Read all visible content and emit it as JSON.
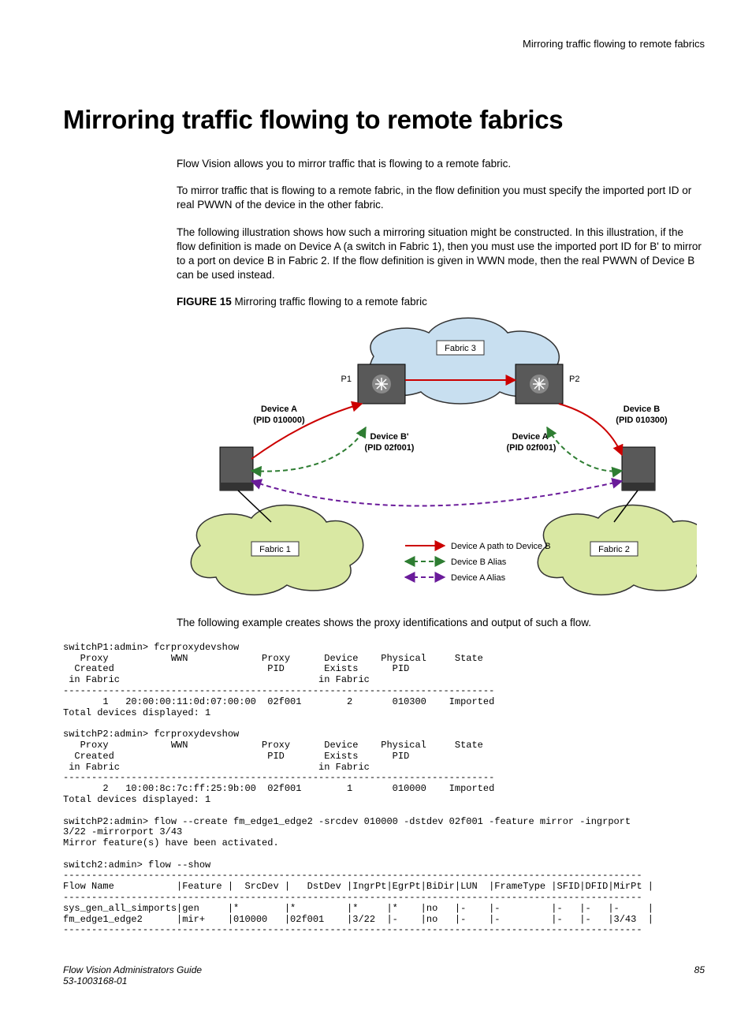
{
  "running_header": "Mirroring traffic flowing to remote fabrics",
  "title": "Mirroring traffic flowing to remote fabrics",
  "para1": "Flow Vision allows you to mirror traffic that is flowing to a remote fabric.",
  "para2": "To mirror traffic that is flowing to a remote fabric, in the flow definition you must specify the imported port ID or real PWWN of the device in the other fabric.",
  "para3": "The following illustration shows how such a mirroring situation might be constructed. In this illustration, if the flow definition is made on Device A (a switch in Fabric 1), then you must use the imported port ID for B' to mirror to a port on device B in Fabric 2. If the flow definition is given in WWN mode, then the real PWWN of Device B can be used instead.",
  "fig_label": "FIGURE 15",
  "fig_title": "Mirroring traffic flowing to a remote fabric",
  "diagram": {
    "fabric3": "Fabric 3",
    "fabric1": "Fabric 1",
    "fabric2": "Fabric 2",
    "p1": "P1",
    "p2": "P2",
    "devA_name": "Device A",
    "devA_pid": "(PID 010000)",
    "devB_name": "Device B",
    "devB_pid": "(PID 010300)",
    "devBp_name": "Device B'",
    "devBp_pid": "(PID 02f001)",
    "devAp_name": "Device A'",
    "devAp_pid": "(PID 02f001)",
    "legend1": "Device A path to Device B",
    "legend2": "Device B Alias",
    "legend3": "Device A Alias"
  },
  "example_intro": "The following example creates shows the proxy identifications and output of such a flow.",
  "code": "switchP1:admin> fcrproxydevshow\n   Proxy           WWN             Proxy      Device    Physical     State\n  Created                           PID       Exists      PID\n in Fabric                                   in Fabric\n----------------------------------------------------------------------------\n       1   20:00:00:11:0d:07:00:00  02f001        2       010300    Imported\nTotal devices displayed: 1\n\nswitchP2:admin> fcrproxydevshow\n   Proxy           WWN             Proxy      Device    Physical     State\n  Created                           PID       Exists      PID\n in Fabric                                   in Fabric\n----------------------------------------------------------------------------\n       2   10:00:8c:7c:ff:25:9b:00  02f001        1       010000    Imported\nTotal devices displayed: 1\n\nswitchP2:admin> flow --create fm_edge1_edge2 -srcdev 010000 -dstdev 02f001 -feature mirror -ingrport \n3/22 -mirrorport 3/43\nMirror feature(s) have been activated.\n\nswitch2:admin> flow --show\n------------------------------------------------------------------------------------------------------\nFlow Name           |Feature |  SrcDev |   DstDev |IngrPt|EgrPt|BiDir|LUN  |FrameType |SFID|DFID|MirPt |\n------------------------------------------------------------------------------------------------------\nsys_gen_all_simports|gen     |*        |*         |*     |*    |no   |-    |-         |-   |-   |-     |\nfm_edge1_edge2      |mir+    |010000   |02f001    |3/22  |-    |no   |-    |-         |-   |-   |3/43  |\n------------------------------------------------------------------------------------------------------",
  "footer_left": "Flow Vision Administrators Guide",
  "footer_doc": "53-1003168-01",
  "footer_page": "85"
}
